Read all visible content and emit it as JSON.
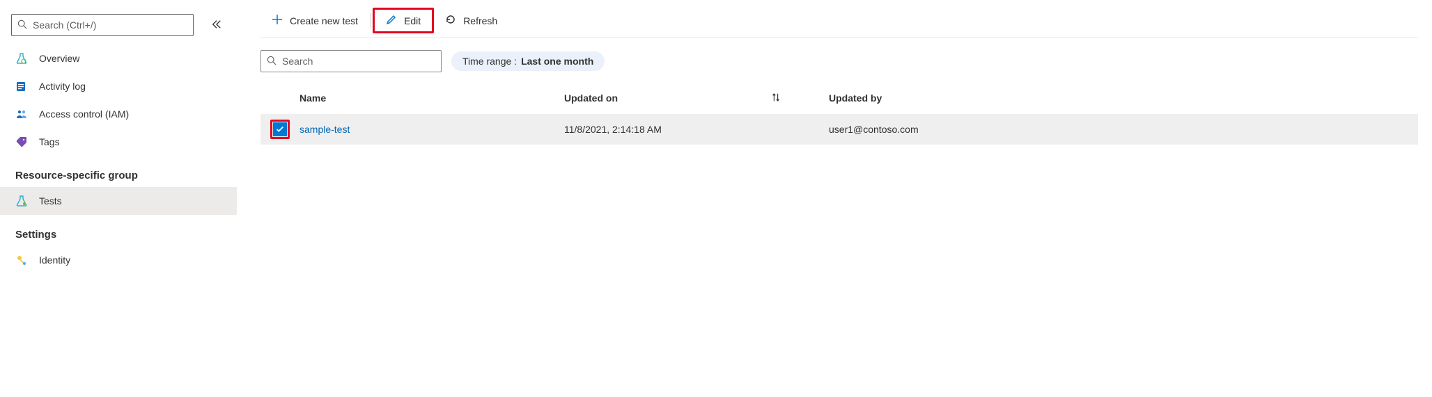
{
  "sidebar": {
    "search_placeholder": "Search (Ctrl+/)",
    "items": [
      {
        "label": "Overview"
      },
      {
        "label": "Activity log"
      },
      {
        "label": "Access control (IAM)"
      },
      {
        "label": "Tags"
      }
    ],
    "group1_header": "Resource-specific group",
    "group1_items": [
      {
        "label": "Tests"
      }
    ],
    "group2_header": "Settings",
    "group2_items": [
      {
        "label": "Identity"
      }
    ]
  },
  "toolbar": {
    "create_label": "Create new test",
    "edit_label": "Edit",
    "refresh_label": "Refresh"
  },
  "filters": {
    "search_placeholder": "Search",
    "time_range_label": "Time range :",
    "time_range_value": "Last one month"
  },
  "table": {
    "headers": {
      "name": "Name",
      "updated_on": "Updated on",
      "updated_by": "Updated by"
    },
    "rows": [
      {
        "checked": true,
        "name": "sample-test",
        "updated_on": "11/8/2021, 2:14:18 AM",
        "updated_by": "user1@contoso.com"
      }
    ]
  }
}
